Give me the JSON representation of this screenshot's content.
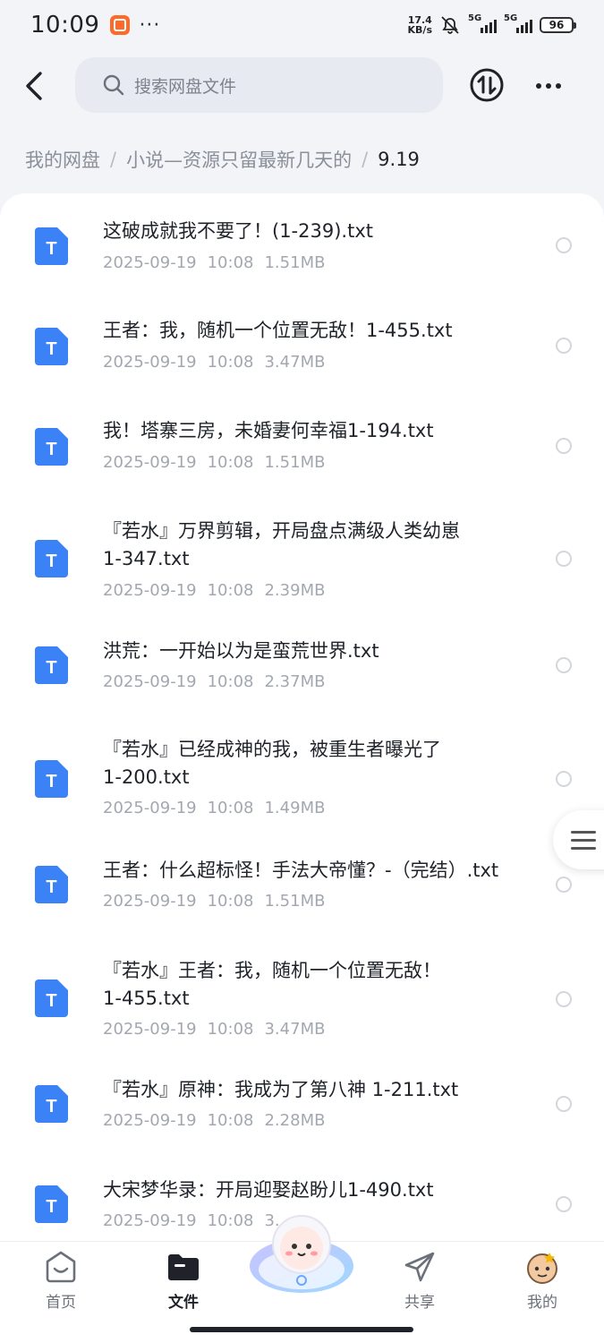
{
  "status_bar": {
    "time": "10:09",
    "dots": "···",
    "speed_value": "17.4",
    "speed_unit": "KB/s",
    "signal1": "5G",
    "signal2": "5G",
    "battery": "96"
  },
  "header": {
    "search_placeholder": "搜索网盘文件"
  },
  "breadcrumb": {
    "items": [
      "我的网盘",
      "小说—资源只留最新几天的",
      "9.19"
    ]
  },
  "files": [
    {
      "name": "这破成就我不要了！(1-239).txt",
      "date": "2025-09-19",
      "time": "10:08",
      "size": "1.51MB"
    },
    {
      "name": "王者：我，随机一个位置无敌！1-455.txt",
      "date": "2025-09-19",
      "time": "10:08",
      "size": "3.47MB"
    },
    {
      "name": "我！塔寨三房，未婚妻何幸福1-194.txt",
      "date": "2025-09-19",
      "time": "10:08",
      "size": "1.51MB"
    },
    {
      "name": "『若水』万界剪辑，开局盘点满级人类幼崽",
      "name_line2": "1-347.txt",
      "date": "2025-09-19",
      "time": "10:08",
      "size": "2.39MB"
    },
    {
      "name": "洪荒：一开始以为是蛮荒世界.txt",
      "date": "2025-09-19",
      "time": "10:08",
      "size": "2.37MB"
    },
    {
      "name": "『若水』已经成神的我，被重生者曝光了",
      "name_line2": "1-200.txt",
      "date": "2025-09-19",
      "time": "10:08",
      "size": "1.49MB"
    },
    {
      "name": "王者：什么超标怪！手法大帝懂？-（完结）.txt",
      "date": "2025-09-19",
      "time": "10:08",
      "size": "1.51MB"
    },
    {
      "name": "『若水』王者：我，随机一个位置无敌！",
      "name_line2": "1-455.txt",
      "date": "2025-09-19",
      "time": "10:08",
      "size": "3.47MB"
    },
    {
      "name": "『若水』原神：我成为了第八神 1-211.txt",
      "date": "2025-09-19",
      "time": "10:08",
      "size": "2.28MB"
    },
    {
      "name": "大宋梦华录：开局迎娶赵盼儿1-490.txt",
      "date": "2025-09-19",
      "time": "10:08",
      "size": "3."
    }
  ],
  "bottom_nav": {
    "home": "首页",
    "files": "文件",
    "share": "共享",
    "mine": "我的"
  },
  "icons": {
    "file_type": "text-file-icon",
    "accent": "#3b82f6"
  }
}
